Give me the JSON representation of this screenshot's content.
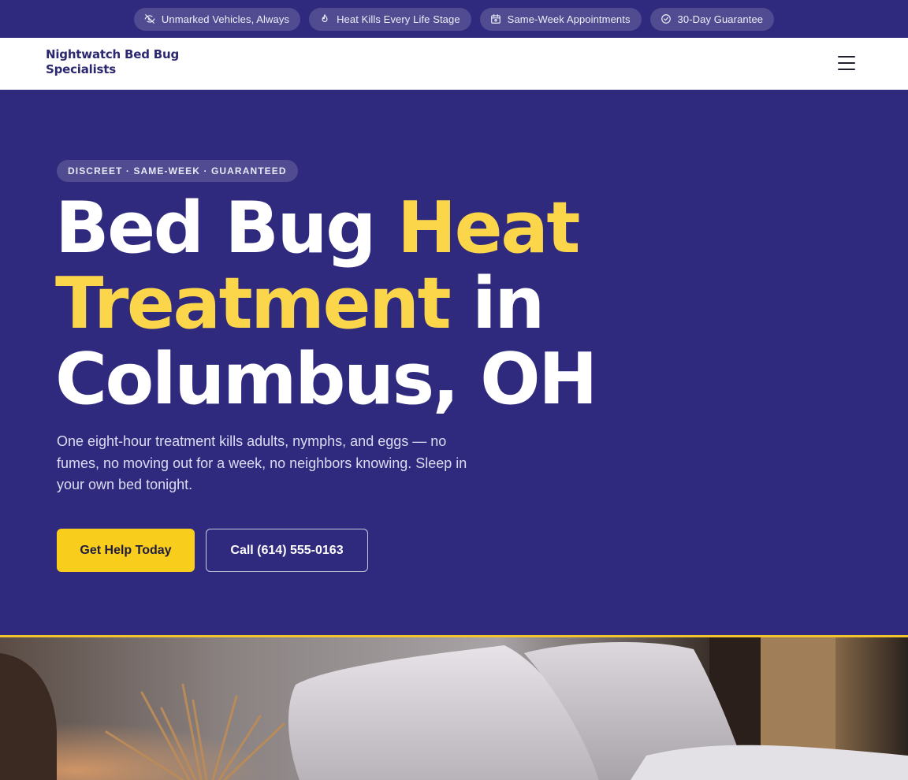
{
  "topbar": {
    "pills": [
      {
        "icon": "eye-off-icon",
        "label": "Unmarked Vehicles, Always"
      },
      {
        "icon": "flame-icon",
        "label": "Heat Kills Every Life Stage"
      },
      {
        "icon": "calendar-icon",
        "label": "Same-Week Appointments"
      },
      {
        "icon": "check-circle-icon",
        "label": "30-Day Guarantee"
      }
    ]
  },
  "header": {
    "brand_line1": "Nightwatch Bed Bug",
    "brand_line2": "Specialists",
    "menu_icon": "hamburger-menu-icon"
  },
  "hero": {
    "eyebrow": "DISCREET · SAME-WEEK · GUARANTEED",
    "headline": {
      "part1": "Bed Bug ",
      "part2": "Heat",
      "part3": "Treatment",
      "part4": " in",
      "part5": "Columbus, OH"
    },
    "lede": "One eight-hour treatment kills adults, nymphs, and eggs — no fumes, no moving out for a week, no neighbors knowing. Sleep in your own bed tonight.",
    "primary_cta": "Get Help Today",
    "secondary_cta": "Call (614) 555-0163"
  },
  "colors": {
    "brand_navy": "#302a7e",
    "accent_yellow": "#fbd54a",
    "button_yellow": "#f9cd1c"
  },
  "photo": {
    "alt_subject": "bed with white pillows and reed diffuser"
  }
}
